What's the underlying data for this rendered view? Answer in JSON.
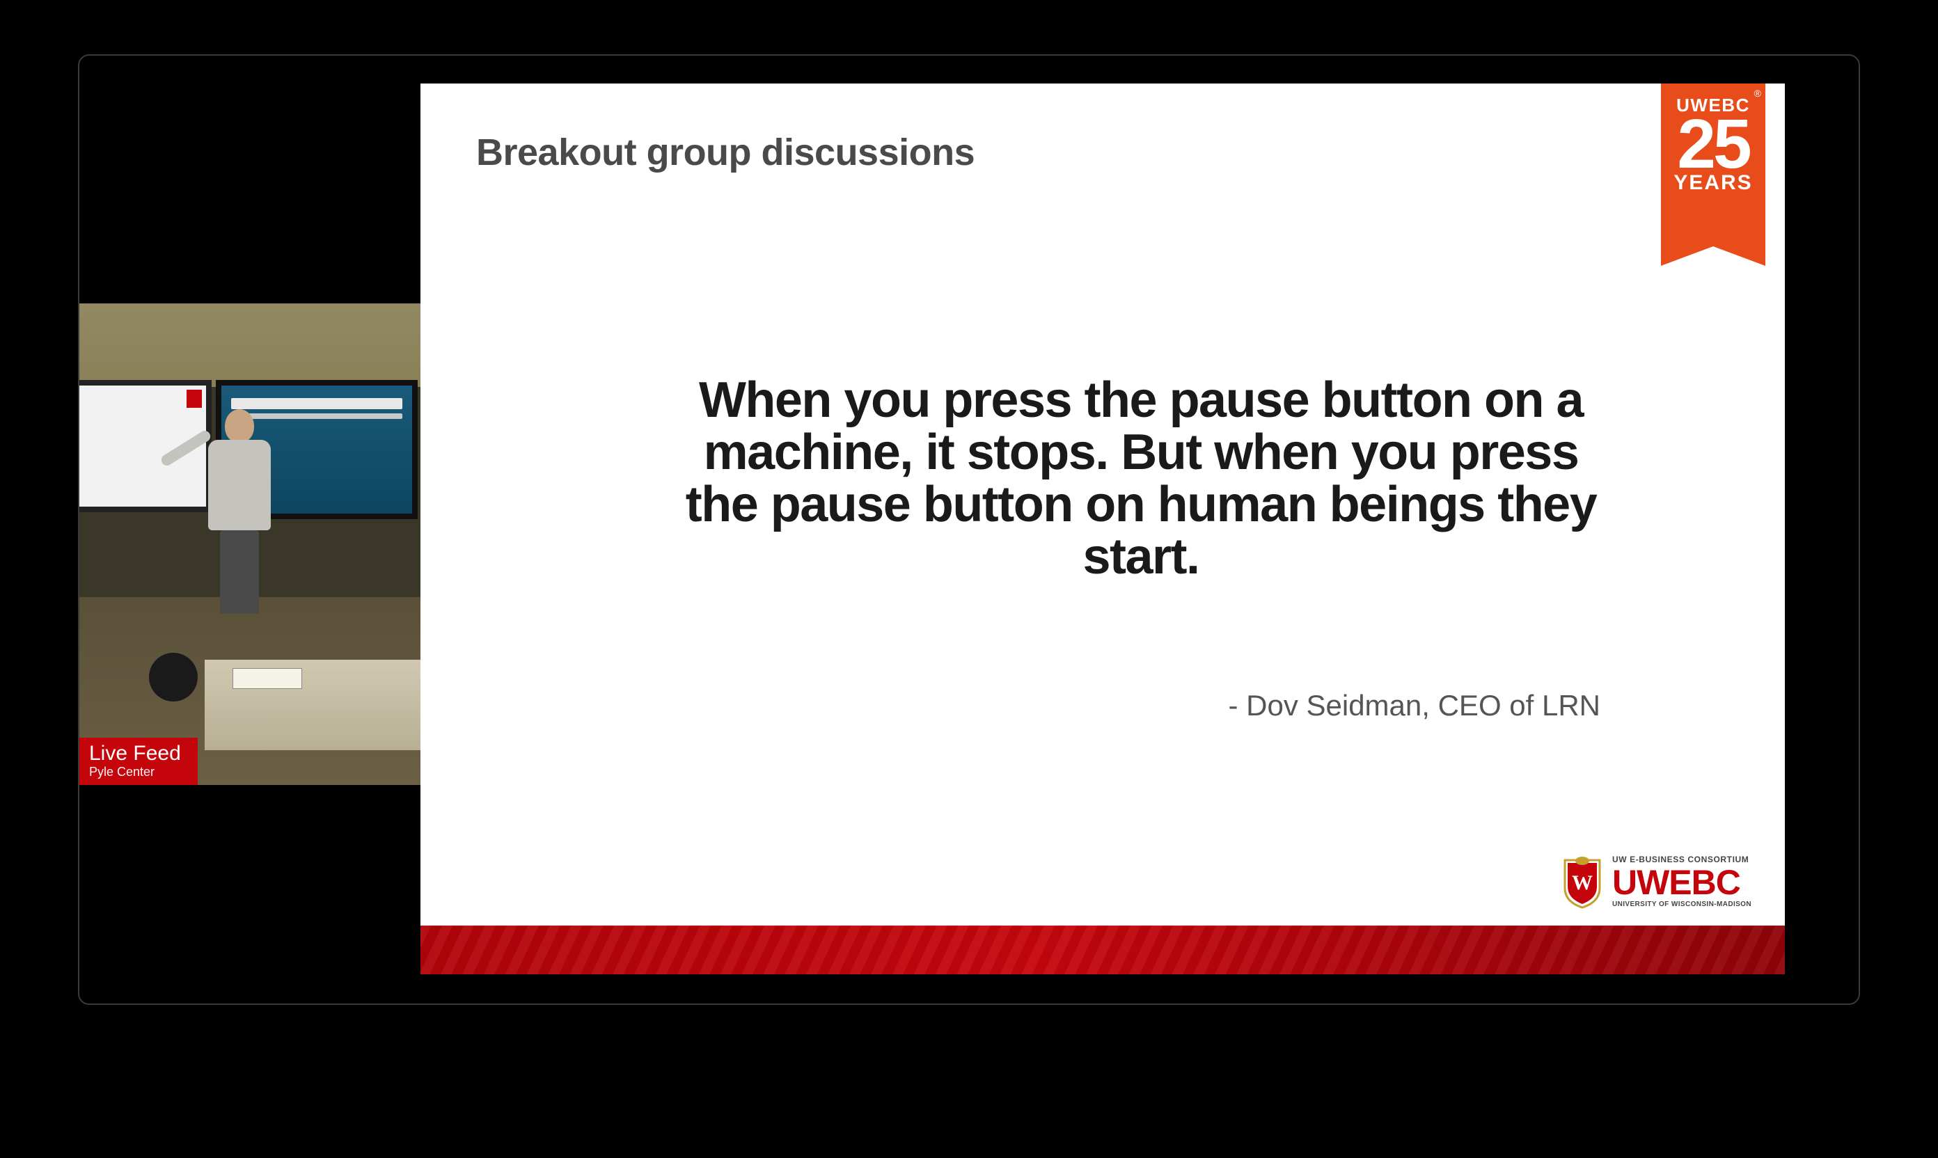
{
  "live_feed": {
    "label_title": "Live Feed",
    "label_subtitle": "Pyle Center"
  },
  "slide": {
    "heading": "Breakout group discussions",
    "quote": "When you press the pause button on a machine, it stops. But when you press the pause button on human beings they start.",
    "attribution": "- Dov Seidman, CEO of LRN"
  },
  "ribbon": {
    "top": "UWEBC",
    "number": "25",
    "bottom": "YEARS",
    "reg": "®"
  },
  "footer_logo": {
    "top": "UW E-BUSINESS CONSORTIUM",
    "main": "UWEBC",
    "bottom": "UNIVERSITY OF WISCONSIN-MADISON",
    "shield_letter": "W"
  }
}
